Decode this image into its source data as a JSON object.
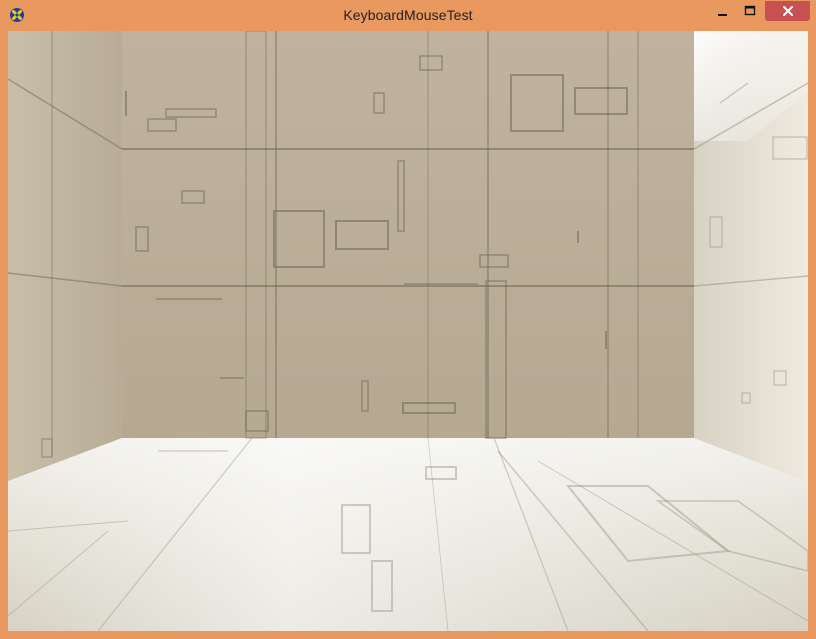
{
  "window": {
    "title": "KeyboardMouseTest",
    "app_icon": "xna-game-icon",
    "controls": {
      "minimize_icon": "minimize-icon",
      "maximize_icon": "maximize-icon",
      "close_icon": "close-icon"
    },
    "colors": {
      "frame": "#e9985f",
      "close_button": "#c75050"
    }
  },
  "scene": {
    "description_icon": "3d-room-viewport"
  }
}
